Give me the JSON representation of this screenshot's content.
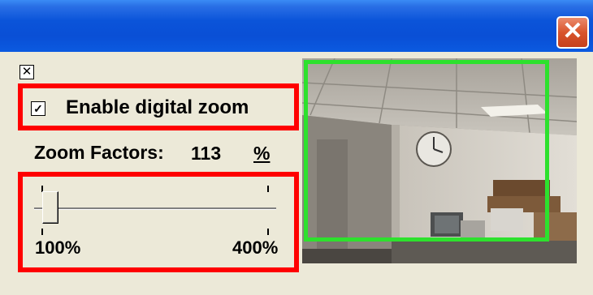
{
  "window": {
    "close_icon": "close-icon",
    "close_glyph": "✕"
  },
  "panel": {
    "mini_close_icon": "close-box-icon",
    "mini_close_glyph": "✕",
    "enable_zoom": {
      "label": "Enable digital zoom",
      "checked": true,
      "check_glyph": "✓"
    },
    "zoom_factors": {
      "label": "Zoom Factors:",
      "value": "113",
      "unit": "%"
    },
    "slider": {
      "min_label": "100%",
      "max_label": "400%",
      "min": 100,
      "max": 400,
      "value": 113
    }
  },
  "colors": {
    "titlebar": "#0b54d9",
    "highlight_box": "#ff0000",
    "zoom_region_frame": "#2de12d",
    "window_background": "#ece9d8"
  }
}
